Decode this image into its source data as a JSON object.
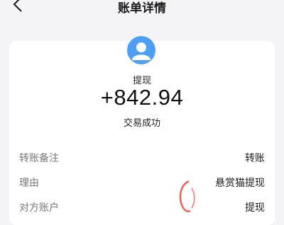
{
  "header": {
    "title": "账单详情",
    "back_icon": "chevron-left-icon"
  },
  "summary": {
    "avatar_icon": "user-avatar-icon",
    "type": "提现",
    "amount": "+842.94",
    "status": "交易成功"
  },
  "details": [
    {
      "label": "转账备注",
      "value": "转账"
    },
    {
      "label": "理由",
      "value": "悬赏猫提现"
    },
    {
      "label": "对方账户",
      "value": "提现"
    }
  ],
  "colors": {
    "accent": "#4d9ef5",
    "background": "#f4f4f6",
    "watermark": "#e8463c"
  }
}
